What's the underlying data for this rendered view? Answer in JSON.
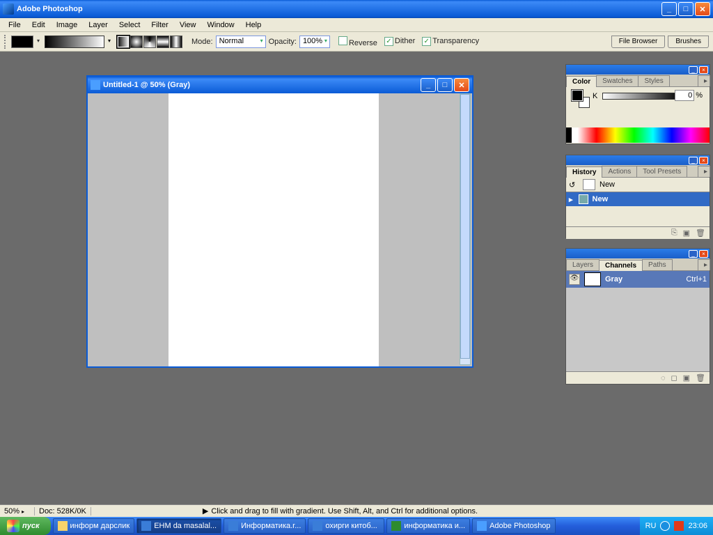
{
  "title": "Adobe Photoshop",
  "menu": [
    "File",
    "Edit",
    "Image",
    "Layer",
    "Select",
    "Filter",
    "View",
    "Window",
    "Help"
  ],
  "options": {
    "mode_label": "Mode:",
    "mode_value": "Normal",
    "opacity_label": "Opacity:",
    "opacity_value": "100%",
    "reverse": "Reverse",
    "dither": "Dither",
    "transparency": "Transparency",
    "file_browser": "File Browser",
    "brushes": "Brushes"
  },
  "document": {
    "title": "Untitled-1 @ 50% (Gray)"
  },
  "color_panel": {
    "tabs": [
      "Color",
      "Swatches",
      "Styles"
    ],
    "k_value": "0",
    "pct": "%"
  },
  "history_panel": {
    "tabs": [
      "History",
      "Actions",
      "Tool Presets"
    ],
    "snapshot": "New",
    "state": "New"
  },
  "layers_panel": {
    "tabs": [
      "Layers",
      "Channels",
      "Paths"
    ],
    "channel": "Gray",
    "shortcut": "Ctrl+1"
  },
  "status": {
    "zoom": "50%",
    "doc": "Doc: 528K/0K",
    "hint": "Click and drag to fill with gradient. Use Shift, Alt, and Ctrl for additional options."
  },
  "taskbar": {
    "start": "пуск",
    "tasks": [
      {
        "label": "информ дарслик",
        "color": "#f7d36a"
      },
      {
        "label": "EHM da masalal...",
        "color": "#3a7dd8",
        "active": true
      },
      {
        "label": "Информатика.r...",
        "color": "#3a7dd8"
      },
      {
        "label": "охирги китоб...",
        "color": "#3a7dd8"
      },
      {
        "label": "информатика и...",
        "color": "#2e8b2e"
      },
      {
        "label": "Adobe Photoshop",
        "color": "#4a9eff"
      }
    ],
    "lang": "RU",
    "time": "23:06"
  }
}
